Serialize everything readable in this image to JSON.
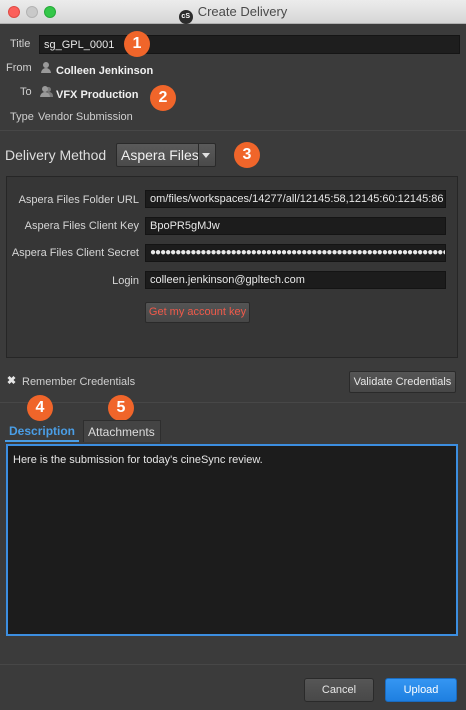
{
  "window": {
    "title": "Create Delivery",
    "app_icon_text": "cS"
  },
  "header": {
    "title_label": "Title",
    "title_value": "sg_GPL_0001",
    "from_label": "From",
    "from_value": "Colleen Jenkinson",
    "to_label": "To",
    "to_value": "VFX Production",
    "type_label": "Type",
    "type_value": "Vendor Submission"
  },
  "badges": [
    "1",
    "2",
    "3",
    "4",
    "5"
  ],
  "delivery": {
    "label": "Delivery Method",
    "selected": "Aspera Files"
  },
  "credentials": {
    "folder_url_label": "Aspera Files Folder URL",
    "folder_url_value": "om/files/workspaces/14277/all/12145:58,12145:60:12145:86",
    "client_key_label": "Aspera Files Client Key",
    "client_key_value": "BpoPR5gMJw",
    "client_secret_label": "Aspera Files Client Secret",
    "client_secret_value": "●●●●●●●●●●●●●●●●●●●●●●●●●●●●●●●●●●●●●●●●●●●●●●●●●●●●●●●●●●●●●",
    "login_label": "Login",
    "login_value": "colleen.jenkinson@gpltech.com",
    "account_key_button": "Get my account key"
  },
  "remember": {
    "checked_glyph": "✖",
    "label": "Remember Credentials"
  },
  "validate_button": "Validate Credentials",
  "tabs": [
    {
      "label": "Description",
      "active": true
    },
    {
      "label": "Attachments",
      "active": false
    }
  ],
  "description_text": "Here is the submission for today's cineSync review.",
  "footer": {
    "cancel": "Cancel",
    "upload": "Upload"
  },
  "colors": {
    "badge": "#f0652a",
    "accent": "#3c8ee0",
    "primary_button": "#1f7fe0",
    "warning_text": "#f05a4a"
  }
}
